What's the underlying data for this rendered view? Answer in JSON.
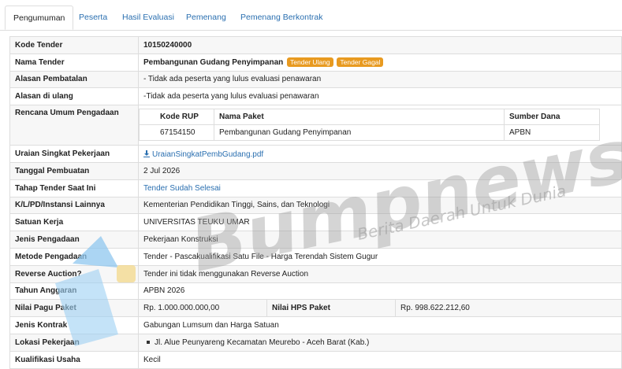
{
  "tabs": [
    {
      "label": "Pengumuman",
      "active": true
    },
    {
      "label": "Peserta",
      "active": false
    },
    {
      "label": "Hasil Evaluasi",
      "active": false
    },
    {
      "label": "Pemenang",
      "active": false
    },
    {
      "label": "Pemenang Berkontrak",
      "active": false
    }
  ],
  "rows": {
    "kode_tender": {
      "label": "Kode Tender",
      "value": "10150240000"
    },
    "nama_tender": {
      "label": "Nama Tender",
      "value": "Pembangunan Gudang Penyimpanan",
      "badge1": "Tender Ulang",
      "badge2": "Tender Gagal"
    },
    "alasan_batal": {
      "label": "Alasan Pembatalan",
      "value": "- Tidak ada peserta yang lulus evaluasi penawaran"
    },
    "alasan_ulang": {
      "label": "Alasan di ulang",
      "value": "-Tidak ada peserta yang lulus evaluasi penawaran"
    },
    "rup": {
      "label": "Rencana Umum Pengadaan",
      "headers": [
        "Kode RUP",
        "Nama Paket",
        "Sumber Dana"
      ],
      "row": [
        "67154150",
        "Pembangunan Gudang Penyimpanan",
        "APBN"
      ]
    },
    "uraian": {
      "label": "Uraian Singkat Pekerjaan",
      "value": "UraianSingkatPembGudang.pdf"
    },
    "tanggal": {
      "label": "Tanggal Pembuatan",
      "value": "2 Jul 2026"
    },
    "tahap": {
      "label": "Tahap Tender Saat Ini",
      "value": "Tender Sudah Selesai"
    },
    "klpd": {
      "label": "K/L/PD/Instansi Lainnya",
      "value": "Kementerian Pendidikan Tinggi, Sains, dan Teknologi"
    },
    "satker": {
      "label": "Satuan Kerja",
      "value": "UNIVERSITAS TEUKU UMAR"
    },
    "jenis": {
      "label": "Jenis Pengadaan",
      "value": "Pekerjaan Konstruksi"
    },
    "metode": {
      "label": "Metode Pengadaan",
      "value": "Tender - Pascakualifikasi Satu File - Harga Terendah Sistem Gugur"
    },
    "reverse": {
      "label": "Reverse Auction?",
      "value": "Tender ini tidak menggunakan Reverse Auction"
    },
    "tahun": {
      "label": "Tahun Anggaran",
      "value": "APBN 2026"
    },
    "pagu": {
      "label": "Nilai Pagu Paket",
      "value": "Rp. 1.000.000.000,00",
      "hps_label": "Nilai HPS Paket",
      "hps_value": "Rp. 998.622.212,60"
    },
    "kontrak": {
      "label": "Jenis Kontrak",
      "value": "Gabungan Lumsum dan Harga Satuan"
    },
    "lokasi": {
      "label": "Lokasi Pekerjaan",
      "value": "Jl. Alue Peunyareng Kecamatan Meurebo - Aceh Barat (Kab.)"
    },
    "kualifikasi": {
      "label": "Kualifikasi Usaha",
      "value": "Kecil"
    }
  },
  "watermark": {
    "brand": "Bumpnews",
    "tagline": "Berita Daerah Untuk Dunia"
  },
  "colors": {
    "link": "#2a6fb0",
    "badge": "#e89a20",
    "watermark": "#9a9a9a"
  }
}
